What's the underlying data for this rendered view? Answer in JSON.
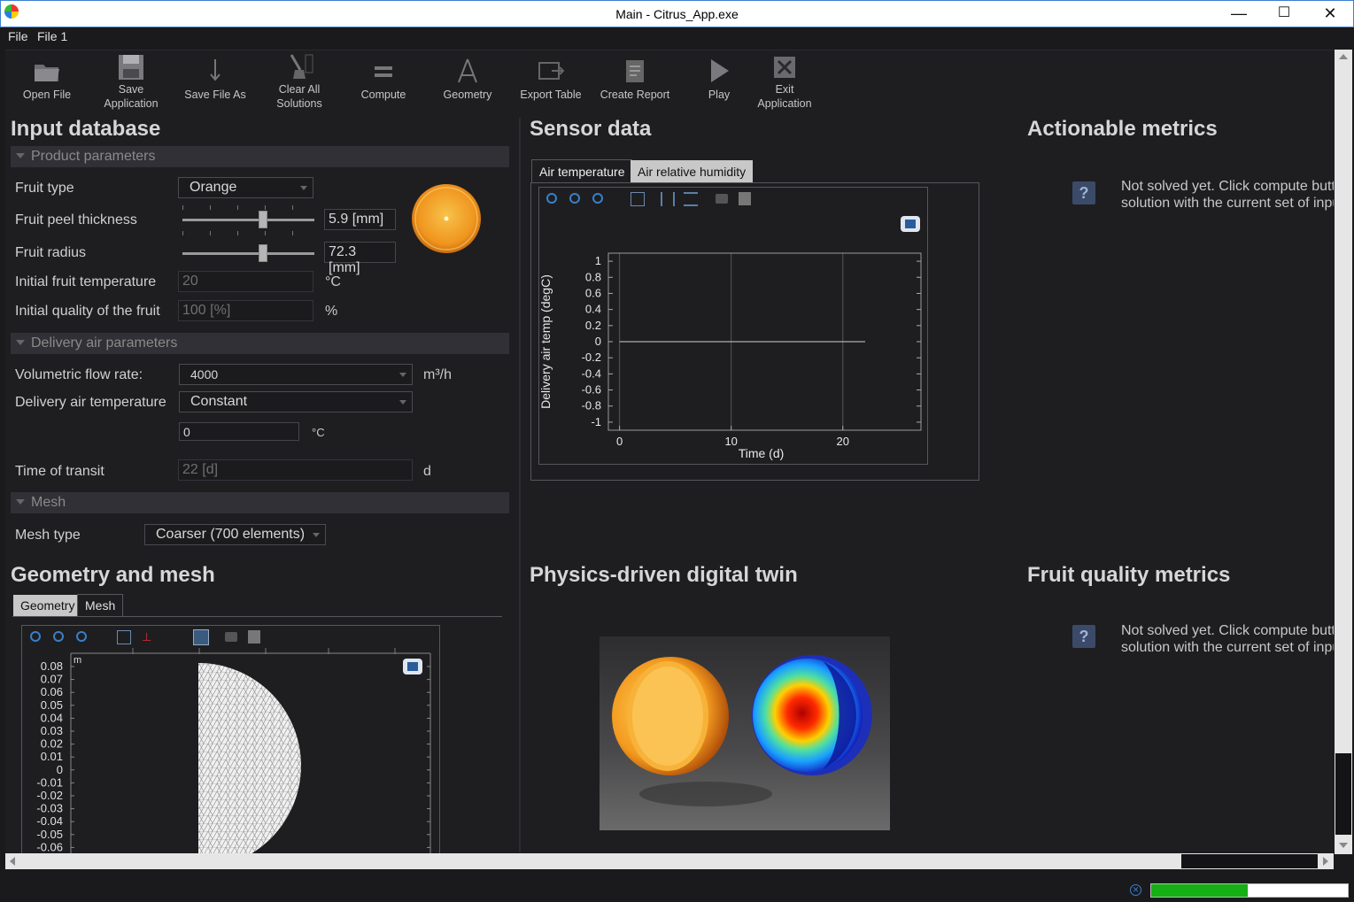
{
  "window": {
    "title": "Main - Citrus_App.exe",
    "minimize": "—",
    "maximize": "☐",
    "close": "✕"
  },
  "menu": [
    "File",
    "File 1"
  ],
  "toolbar": {
    "open_file": "Open File",
    "save_app_1": "Save",
    "save_app_2": "Application",
    "save_file_as": "Save File As",
    "clear_all_1": "Clear All",
    "clear_all_2": "Solutions",
    "compute": "Compute",
    "geometry": "Geometry",
    "export_table": "Export Table",
    "create_report": "Create Report",
    "play": "Play",
    "exit_1": "Exit",
    "exit_2": "Application"
  },
  "input": {
    "heading": "Input database",
    "product_section": "Product parameters",
    "fruit_type_label": "Fruit type",
    "fruit_type_value": "Orange",
    "peel_label": "Fruit peel thickness",
    "peel_value": "5.9 [mm]",
    "peel_slider_fraction": 0.62,
    "radius_label": "Fruit radius",
    "radius_value": "72.3 [mm]",
    "radius_slider_fraction": 0.62,
    "init_temp_label": "Initial fruit temperature",
    "init_temp_value": "20",
    "init_temp_unit": "°C",
    "init_quality_label": "Initial quality of the fruit",
    "init_quality_value": "100 [%]",
    "init_quality_unit": "%",
    "delivery_section": "Delivery air parameters",
    "flow_label": "Volumetric flow rate:",
    "flow_value": "4000",
    "flow_unit": "m³/h",
    "air_temp_label": "Delivery air temperature",
    "air_temp_value": "Constant",
    "air_temp_const": "0",
    "air_temp_unit": "°C",
    "transit_label": "Time of transit",
    "transit_value": "22 [d]",
    "transit_unit": "d",
    "mesh_section": "Mesh",
    "mesh_type_label": "Mesh type",
    "mesh_type_value": "Coarser (700 elements)"
  },
  "geometry_panel": {
    "heading": "Geometry and mesh",
    "tabs": [
      "Geometry",
      "Mesh"
    ],
    "unit": "m",
    "y_ticks": [
      "0.08",
      "0.07",
      "0.06",
      "0.05",
      "0.04",
      "0.03",
      "0.02",
      "0.01",
      "0",
      "-0.01",
      "-0.02",
      "-0.03",
      "-0.04",
      "-0.05",
      "-0.06"
    ]
  },
  "sensor": {
    "heading": "Sensor data",
    "tabs": [
      "Air temperature",
      "Air relative humidity"
    ]
  },
  "chart_data": {
    "type": "line",
    "xlabel": "Time (d)",
    "ylabel": "Delivery air temp (degC)",
    "xlim": [
      -1,
      27
    ],
    "ylim": [
      -1.1,
      1.1
    ],
    "x_ticks": [
      0,
      10,
      20
    ],
    "y_ticks": [
      1,
      0.8,
      0.6,
      0.4,
      0.2,
      0,
      -0.2,
      -0.4,
      -0.6,
      -0.8,
      -1
    ],
    "y_tick_labels": [
      "1",
      "0.8",
      "0.6",
      "0.4",
      "0.2",
      "0",
      "-0.2",
      "-0.4",
      "-0.6",
      "-0.8",
      "-1"
    ],
    "grid": true,
    "series": [
      {
        "x": [
          0,
          22
        ],
        "y": [
          0,
          0
        ]
      }
    ]
  },
  "metrics": {
    "heading": "Actionable metrics",
    "message_1": "Not solved yet. Click compute butto",
    "message_2": "solution with the current set of input"
  },
  "twin": {
    "heading": "Physics-driven digital twin"
  },
  "quality": {
    "heading": "Fruit quality metrics",
    "message_1": "Not solved yet. Click compute butto",
    "message_2": "solution with the current set of input"
  },
  "status": {
    "progress_fraction": 0.49
  },
  "colors": {
    "progress": "#14b014",
    "accent_blue": "#3a7fc8"
  }
}
